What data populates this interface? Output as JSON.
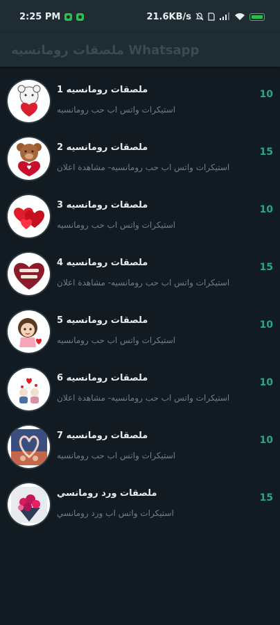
{
  "status_bar": {
    "time": "2:25 PM",
    "network_speed": "21.6KB/s",
    "icons": [
      "mute-icon",
      "sim-icon",
      "signal-icon",
      "wifi-icon",
      "battery-icon"
    ],
    "accent_color": "#2bbf4e"
  },
  "app_bar": {
    "title": "ملصقات رومانسيه Whatsapp"
  },
  "packs": [
    {
      "name": "ملصقات رومانسيه 1",
      "subtitle": "استيكرات واتس اب حب رومانسيه",
      "count": "10",
      "icon": "teddy-heart-sticker"
    },
    {
      "name": "ملصقات رومانسيه 2",
      "subtitle": "استيكرات واتس اب حب رومانسيه- مشاهدة اعلان",
      "count": "15",
      "icon": "bear-heart-sticker"
    },
    {
      "name": "ملصقات رومانسيه 3",
      "subtitle": "استيكرات واتس اب حب رومانسيه",
      "count": "10",
      "icon": "red-hearts-sticker"
    },
    {
      "name": "ملصقات رومانسيه 4",
      "subtitle": "استيكرات واتس اب حب رومانسيه- مشاهدة اعلان",
      "count": "15",
      "icon": "heart-text-sticker"
    },
    {
      "name": "ملصقات رومانسيه 5",
      "subtitle": "استيكرات واتس اب حب رومانسيه",
      "count": "10",
      "icon": "girl-sticker"
    },
    {
      "name": "ملصقات رومانسيه 6",
      "subtitle": "استيكرات واتس اب حب رومانسيه- مشاهدة اعلان",
      "count": "10",
      "icon": "couple-sticker"
    },
    {
      "name": "ملصقات رومانسيه 7",
      "subtitle": "استيكرات واتس اب حب رومانسيه",
      "count": "10",
      "icon": "hands-heart-sticker"
    },
    {
      "name": "ملصقات ورد رومانسي",
      "subtitle": "استيكرات واتس اب  ورد رومانسي",
      "count": "15",
      "icon": "roses-bouquet-sticker"
    }
  ],
  "colors": {
    "background": "#121b22",
    "bar": "#1f2c34",
    "count": "#2aa58a",
    "subtitle": "#6f7f88"
  }
}
